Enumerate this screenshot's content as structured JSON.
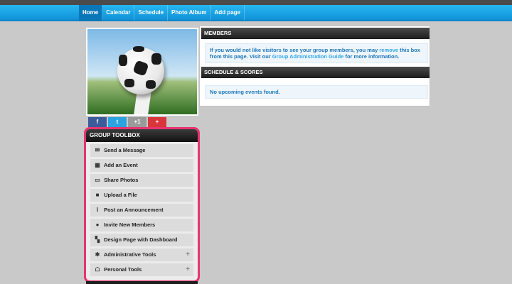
{
  "nav": {
    "items": [
      {
        "label": "Home",
        "active": true
      },
      {
        "label": "Calendar"
      },
      {
        "label": "Schedule"
      },
      {
        "label": "Photo Album"
      },
      {
        "label": "Add page"
      }
    ]
  },
  "social": {
    "facebook": "f",
    "twitter": "t",
    "googleplus": "+1",
    "more": "+"
  },
  "toolbox": {
    "title": "GROUP TOOLBOX",
    "items": [
      {
        "label": "Send a Message",
        "icon": "✉"
      },
      {
        "label": "Add an Event",
        "icon": "▦"
      },
      {
        "label": "Share Photos",
        "icon": "▭"
      },
      {
        "label": "Upload a File",
        "icon": "■"
      },
      {
        "label": "Post an Announcement",
        "icon": "⌇"
      },
      {
        "label": "Invite New Members",
        "icon": "●"
      },
      {
        "label": "Design Page with Dashboard",
        "icon": "▚"
      },
      {
        "label": "Administrative Tools",
        "icon": "✱",
        "expand": "+"
      },
      {
        "label": "Personal Tools",
        "icon": "☖",
        "expand": "+"
      }
    ]
  },
  "members": {
    "title": "MEMBERS",
    "text1": "If you would not like visitors to see your group members, you may ",
    "link1": "remove",
    "text2": " this box from this page. Visit our ",
    "link2": "Group Administration Guide",
    "text3": " for more information."
  },
  "schedule": {
    "title": "SCHEDULE & SCORES",
    "text": "No upcoming events found."
  }
}
